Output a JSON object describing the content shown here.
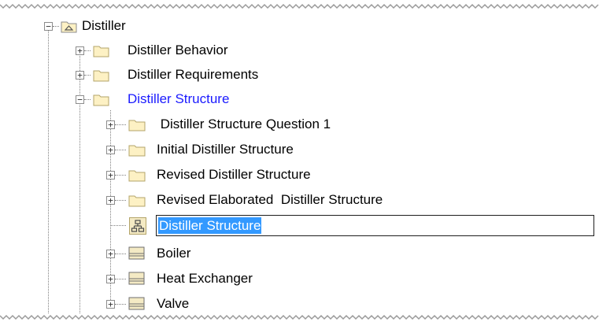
{
  "root": {
    "label": "Distiller",
    "expander": "−",
    "icon": "model-package-icon"
  },
  "children": [
    {
      "label": "Distiller Behavior",
      "expander": "+",
      "icon": "folder-icon"
    },
    {
      "label": "Distiller Requirements",
      "expander": "+",
      "icon": "folder-icon"
    },
    {
      "label": "Distiller Structure",
      "expander": "−",
      "icon": "folder-icon",
      "color": "#1a1aff"
    }
  ],
  "structure_children": [
    {
      "label": " Distiller Structure Question 1",
      "expander": "+",
      "icon": "folder-icon"
    },
    {
      "label": "Initial Distiller Structure",
      "expander": "+",
      "icon": "folder-icon"
    },
    {
      "label": "Revised Distiller Structure",
      "expander": "+",
      "icon": "folder-icon"
    },
    {
      "label": "Revised Elaborated  Distiller Structure",
      "expander": "+",
      "icon": "folder-icon"
    },
    {
      "label": "Distiller Structure",
      "icon": "block-diagram-icon",
      "editing": true
    },
    {
      "label": "Boiler",
      "expander": "+",
      "icon": "block-icon"
    },
    {
      "label": "Heat Exchanger",
      "expander": "+",
      "icon": "block-icon"
    },
    {
      "label": "Valve",
      "expander": "+",
      "icon": "block-icon"
    }
  ],
  "colors": {
    "selection": "#3399ff",
    "link_text": "#1a1aff",
    "folder_fill": "#fdf1c4",
    "folder_stroke": "#b3a46a"
  }
}
